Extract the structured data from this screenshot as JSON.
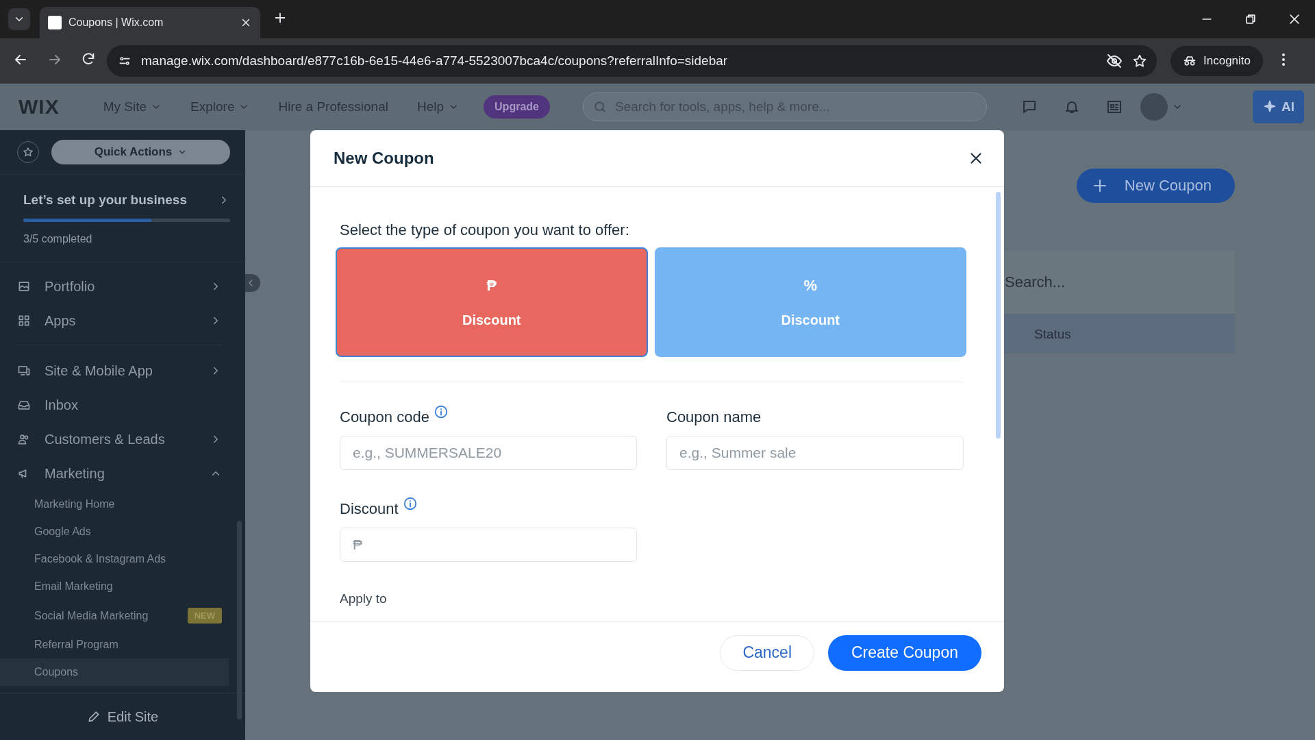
{
  "browser": {
    "tabs": [
      {
        "title": "Coupons | Wix.com",
        "selected": true
      }
    ],
    "address": "manage.wix.com/dashboard/e877c16b-6e15-44e6-a774-5523007bca4c/coupons?referralInfo=sidebar",
    "incognito": "Incognito"
  },
  "topbar": {
    "logo": "WIX",
    "nav": [
      {
        "label": "My Site",
        "menu": true
      },
      {
        "label": "Explore",
        "menu": true
      },
      {
        "label": "Hire a Professional",
        "menu": false
      },
      {
        "label": "Help",
        "menu": true
      }
    ],
    "upgrade": "Upgrade",
    "search_placeholder": "Search for tools, apps, help & more...",
    "ai": "AI"
  },
  "sidebar": {
    "quick_actions": "Quick Actions",
    "setup": {
      "title": "Let’s set up your business",
      "level": 0.62,
      "status": "3/5 completed"
    },
    "sections": [
      {
        "items": [
          {
            "label": "Portfolio",
            "expanded": false
          },
          {
            "label": "Apps",
            "expanded": false
          }
        ]
      },
      {
        "items": [
          {
            "label": "Site & Mobile App",
            "expanded": false
          },
          {
            "label": "Inbox"
          },
          {
            "label": "Customers & Leads",
            "expanded": false
          },
          {
            "label": "Marketing",
            "expanded": true,
            "children": [
              {
                "label": "Marketing Home",
                "selected": false
              },
              {
                "label": "Google Ads",
                "selected": false
              },
              {
                "label": "Facebook & Instagram Ads",
                "selected": false
              },
              {
                "label": "Email Marketing",
                "selected": false
              },
              {
                "label": "Social Media Marketing",
                "selected": false,
                "badge": "NEW"
              },
              {
                "label": "Referral Program",
                "selected": false
              },
              {
                "label": "Coupons",
                "selected": true
              }
            ]
          }
        ]
      }
    ],
    "edit_site": "Edit Site"
  },
  "page": {
    "new_coupon": "New Coupon",
    "search_placeholder": "Search...",
    "columns": [
      "Status"
    ]
  },
  "modal": {
    "title": "New Coupon",
    "prompt": "Select the type of coupon you want to offer:",
    "coupon_types": [
      {
        "symbol": "₱",
        "label": "Discount",
        "color": "#e8685f",
        "selected": true
      },
      {
        "symbol": "%",
        "label": "Discount",
        "color": "#76b5f3",
        "selected": false
      }
    ],
    "fields": [
      {
        "label": "Coupon code",
        "info": true,
        "placeholder": "e.g., SUMMERSALE20"
      },
      {
        "label": "Coupon name",
        "info": false,
        "placeholder": "e.g., Summer sale"
      },
      {
        "label": "Discount",
        "info": true,
        "prefix": "₱"
      }
    ],
    "apply_to": "Apply to",
    "cancel": "Cancel",
    "create": "Create Coupon"
  }
}
